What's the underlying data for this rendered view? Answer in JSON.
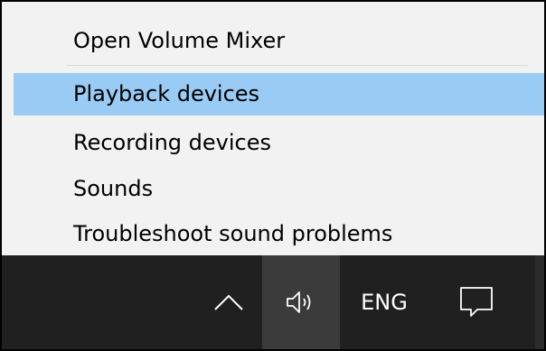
{
  "menu": {
    "items": [
      {
        "label": "Open Volume Mixer"
      },
      {
        "label": "Playback devices",
        "selected": true
      },
      {
        "label": "Recording devices"
      },
      {
        "label": "Sounds"
      },
      {
        "label": "Troubleshoot sound problems"
      }
    ],
    "highlight_color": "#99cbf5",
    "background_color": "#f2f2f2"
  },
  "taskbar": {
    "background_color": "#202020",
    "volume_button_color": "#3b3b3b",
    "chevron_icon": "chevron-up-icon",
    "volume_icon": "speaker-volume-icon",
    "language": "ENG",
    "action_center_icon": "action-center-icon"
  }
}
